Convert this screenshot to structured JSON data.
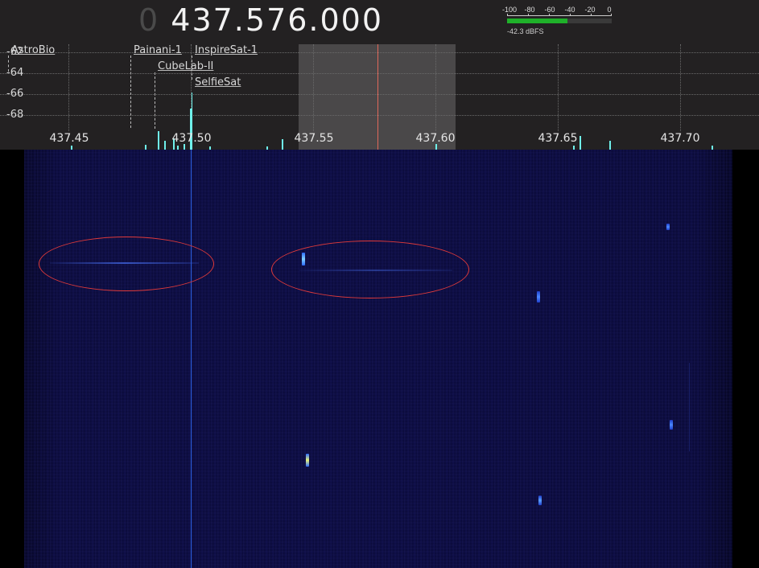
{
  "frequency": {
    "leading_digit": "0",
    "value": "437.576.000"
  },
  "signal_meter": {
    "scale_labels": [
      "-100",
      "-80",
      "-60",
      "-40",
      "-20",
      "0"
    ],
    "level_text": "-42.3 dBFS",
    "level_dbfs": -42.3,
    "bar_color": "#1fb12a"
  },
  "spectrum": {
    "db_labels": [
      "-62",
      "-64",
      "-66",
      "-68"
    ],
    "freq_labels": [
      "437.45",
      "437.50",
      "437.55",
      "437.60",
      "437.65",
      "437.70"
    ],
    "satellites": [
      "AstroBio",
      "Painani-1",
      "InspireSat-1",
      "CubeLab-II",
      "SelfieSat"
    ],
    "center_line_color": "#e0685a",
    "trace_color": "#6ff0ea"
  },
  "waterfall": {
    "marker_line_color": "#2a5fe0",
    "annotation_color": "#e03a3a",
    "annotations": 2
  }
}
